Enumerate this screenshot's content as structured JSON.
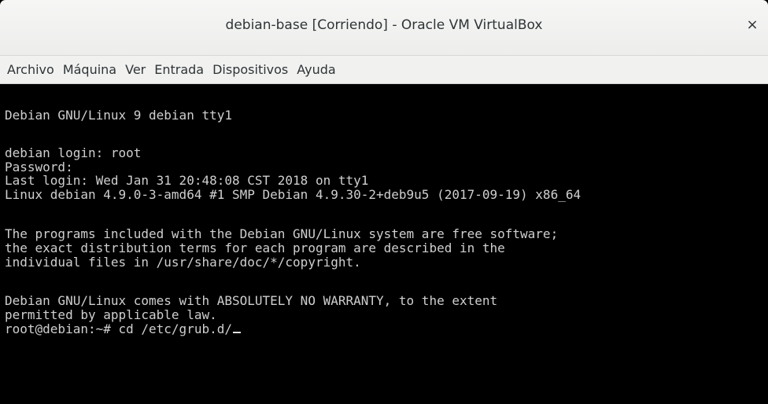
{
  "window": {
    "title": "debian-base [Corriendo] - Oracle VM VirtualBox",
    "close_glyph": "×"
  },
  "menu": {
    "items": [
      "Archivo",
      "Máquina",
      "Ver",
      "Entrada",
      "Dispositivos",
      "Ayuda"
    ]
  },
  "terminal": {
    "lines": [
      "Debian GNU/Linux 9 debian tty1",
      "debian login: root",
      "Password:",
      "Last login: Wed Jan 31 20:48:08 CST 2018 on tty1",
      "Linux debian 4.9.0-3-amd64 #1 SMP Debian 4.9.30-2+deb9u5 (2017-09-19) x86_64",
      "The programs included with the Debian GNU/Linux system are free software;",
      "the exact distribution terms for each program are described in the",
      "individual files in /usr/share/doc/*/copyright.",
      "Debian GNU/Linux comes with ABSOLUTELY NO WARRANTY, to the extent",
      "permitted by applicable law.",
      "root@debian:~# cd /etc/grub.d/"
    ]
  }
}
